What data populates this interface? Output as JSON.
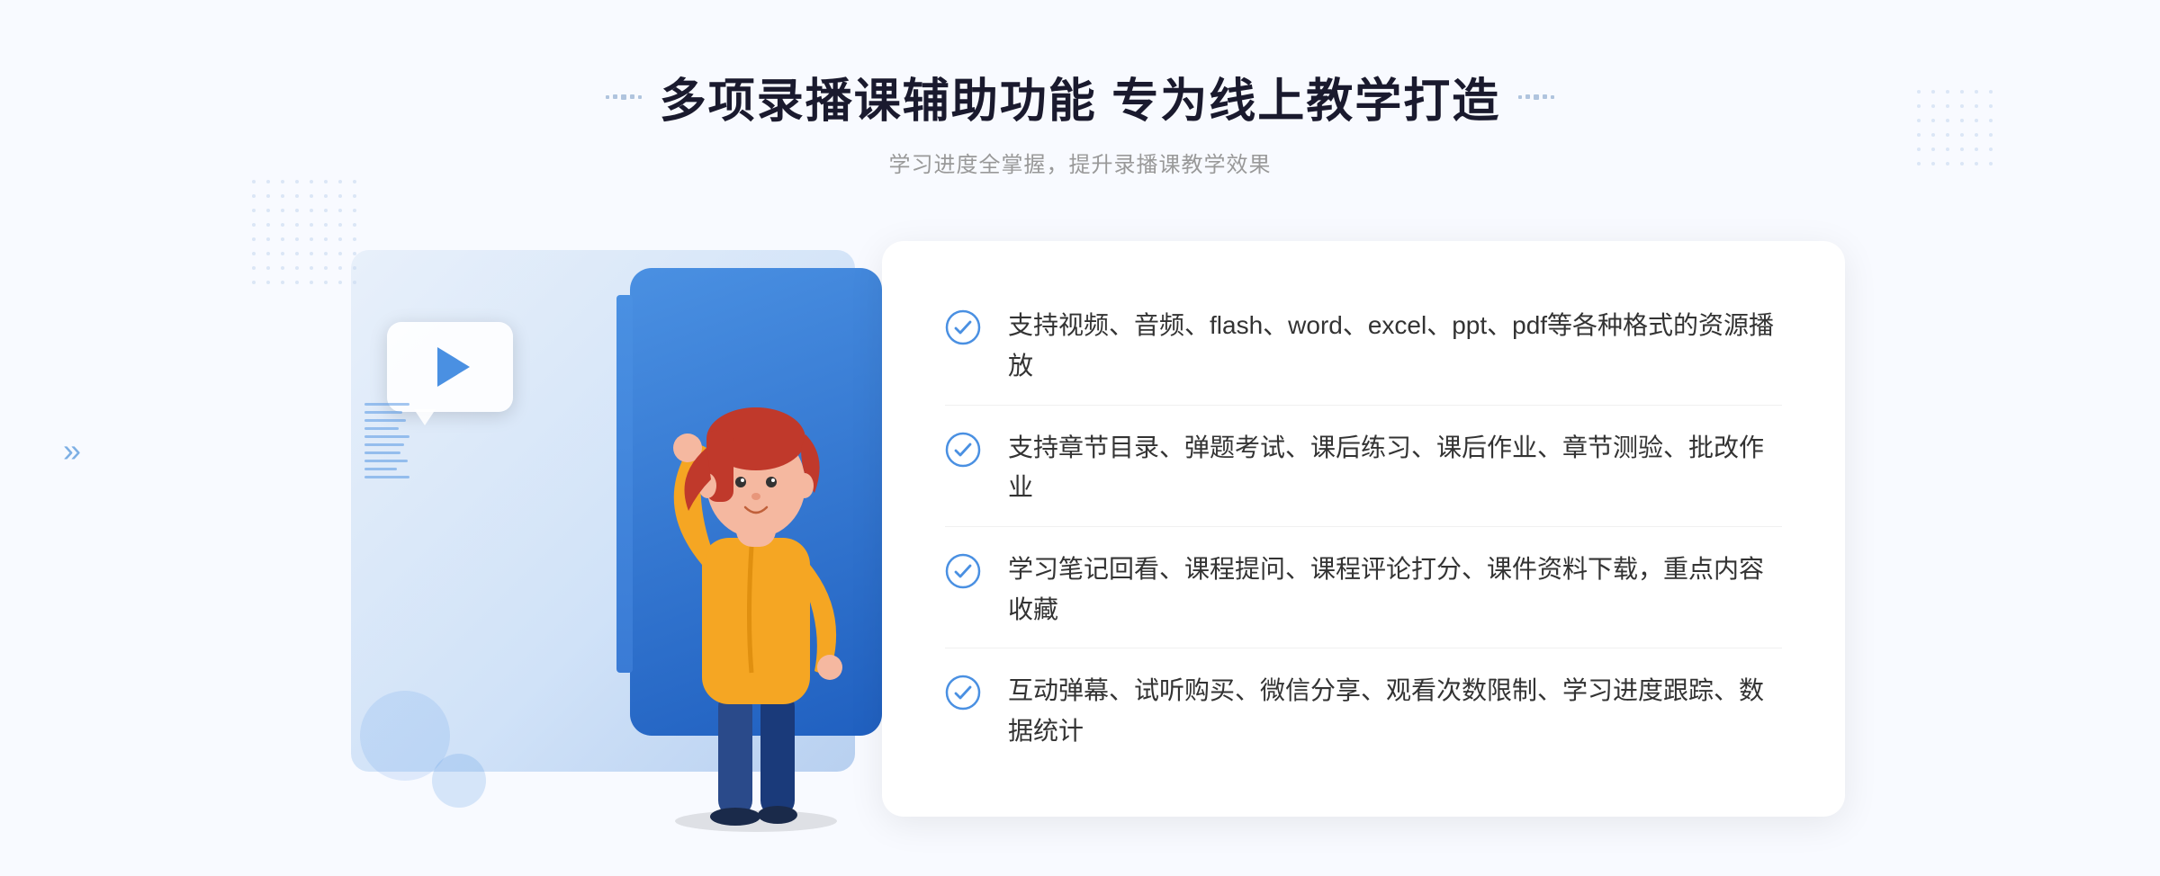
{
  "header": {
    "title": "多项录播课辅助功能 专为线上教学打造",
    "subtitle": "学习进度全掌握，提升录播课教学效果"
  },
  "features": [
    {
      "id": "feature-1",
      "text": "支持视频、音频、flash、word、excel、ppt、pdf等各种格式的资源播放"
    },
    {
      "id": "feature-2",
      "text": "支持章节目录、弹题考试、课后练习、课后作业、章节测验、批改作业"
    },
    {
      "id": "feature-3",
      "text": "学习笔记回看、课程提问、课程评论打分、课件资料下载，重点内容收藏"
    },
    {
      "id": "feature-4",
      "text": "互动弹幕、试听购买、微信分享、观看次数限制、学习进度跟踪、数据统计"
    }
  ],
  "decoration": {
    "chevron": "»",
    "check_color": "#4a90e2"
  }
}
